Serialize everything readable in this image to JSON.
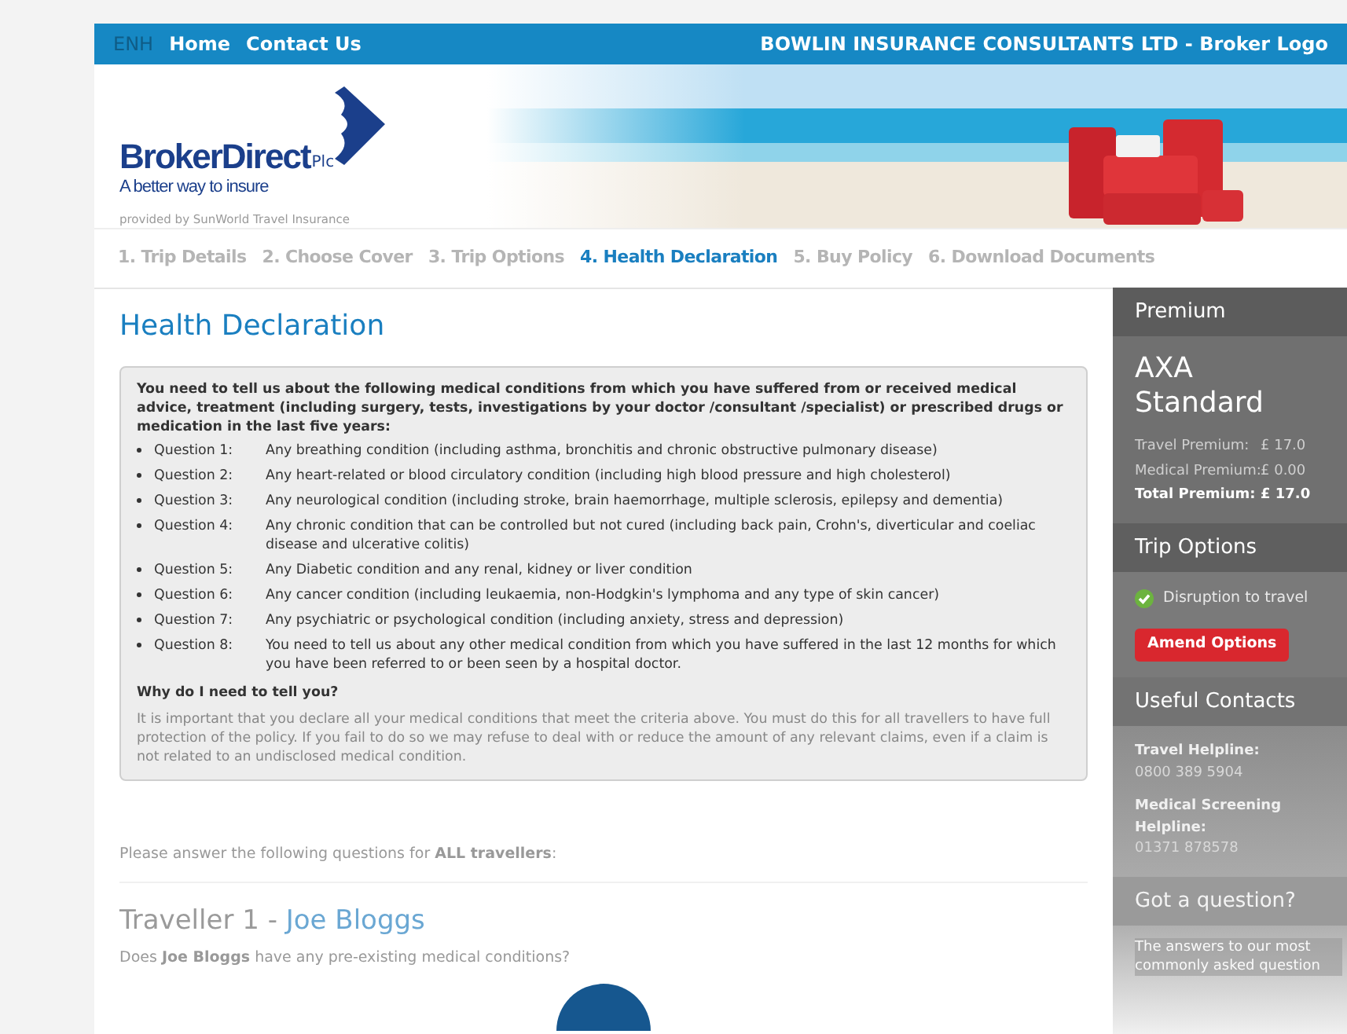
{
  "topbar": {
    "language": "ENH",
    "links": [
      "Home",
      "Contact Us"
    ],
    "broker": "BOWLIN INSURANCE CONSULTANTS LTD - Broker Logo"
  },
  "logo": {
    "name": "BrokerDirect",
    "suffix": "Plc",
    "tagline": "A better way to insure",
    "provider": "provided by SunWorld Travel Insurance"
  },
  "steps": [
    {
      "label": "1. Trip Details",
      "selected": false
    },
    {
      "label": "2. Choose Cover",
      "selected": false
    },
    {
      "label": "3. Trip Options",
      "selected": false
    },
    {
      "label": "4. Health Declaration",
      "selected": true
    },
    {
      "label": "5. Buy Policy",
      "selected": false
    },
    {
      "label": "6. Download Documents",
      "selected": false
    }
  ],
  "heading": "Health Declaration",
  "declaration": {
    "intro": "You need to tell us about the following medical conditions from which you have suffered from or received medical advice, treatment (including surgery, tests, investigations by your doctor /consultant /specialist) or prescribed drugs or medication in the last five years:",
    "questions": [
      {
        "label": "Question 1:",
        "text": "Any breathing condition (including asthma, bronchitis and chronic obstructive pulmonary disease)"
      },
      {
        "label": "Question 2:",
        "text": "Any heart-related or blood circulatory condition (including high blood pressure and high cholesterol)"
      },
      {
        "label": "Question 3:",
        "text": "Any neurological condition (including stroke, brain haemorrhage, multiple sclerosis, epilepsy and dementia)"
      },
      {
        "label": "Question 4:",
        "text": "Any chronic condition that can be controlled but not cured (including back pain, Crohn's, diverticular and coeliac disease and ulcerative colitis)"
      },
      {
        "label": "Question 5:",
        "text": "Any Diabetic condition and any renal, kidney or liver condition"
      },
      {
        "label": "Question 6:",
        "text": "Any cancer condition (including leukaemia, non-Hodgkin's lymphoma and any type of skin cancer)"
      },
      {
        "label": "Question 7:",
        "text": "Any psychiatric or psychological condition (including anxiety, stress and depression)"
      },
      {
        "label": "Question 8:",
        "text": "You need to tell us about any other medical condition from which you have suffered in the last 12 months for which you have been referred to or been seen by a hospital doctor."
      }
    ],
    "why_heading": "Why do I need to tell you?",
    "why_text": "It is important that you declare all your medical conditions that meet the criteria above. You must do this for all travellers to have full protection of the policy. If you fail to do so we may refuse to deal with or reduce the amount of any relevant claims, even if a claim is not related to an undisclosed medical condition."
  },
  "instruction": "Please answer the following questions for **ALL travellers**:",
  "traveller": {
    "prefix": "Traveller 1 - ",
    "name": "Joe Bloggs",
    "question": "Does **Joe Bloggs** have any pre-existing medical conditions?"
  },
  "sidebar": {
    "premium": {
      "title": "Premium",
      "product": "AXA Standard",
      "lines": [
        {
          "label": "Travel Premium:",
          "value": "£ 17.0",
          "total": false
        },
        {
          "label": "Medical Premium:",
          "value": "£ 0.00",
          "total": false
        },
        {
          "label": "Total Premium:",
          "value": "£ 17.0",
          "total": true
        }
      ]
    },
    "trip_options": {
      "title": "Trip Options",
      "options": [
        {
          "label": "Disruption to travel",
          "checked": true
        }
      ],
      "button": "Amend Options"
    },
    "contacts": {
      "title": "Useful Contacts",
      "items": [
        {
          "label": "Travel Helpline:",
          "value": "0800 389 5904"
        },
        {
          "label": "Medical Screening Helpline:",
          "value": "01371 878578"
        }
      ]
    },
    "question": {
      "title": "Got a question?",
      "text": "The answers to our most commonly asked question"
    }
  }
}
